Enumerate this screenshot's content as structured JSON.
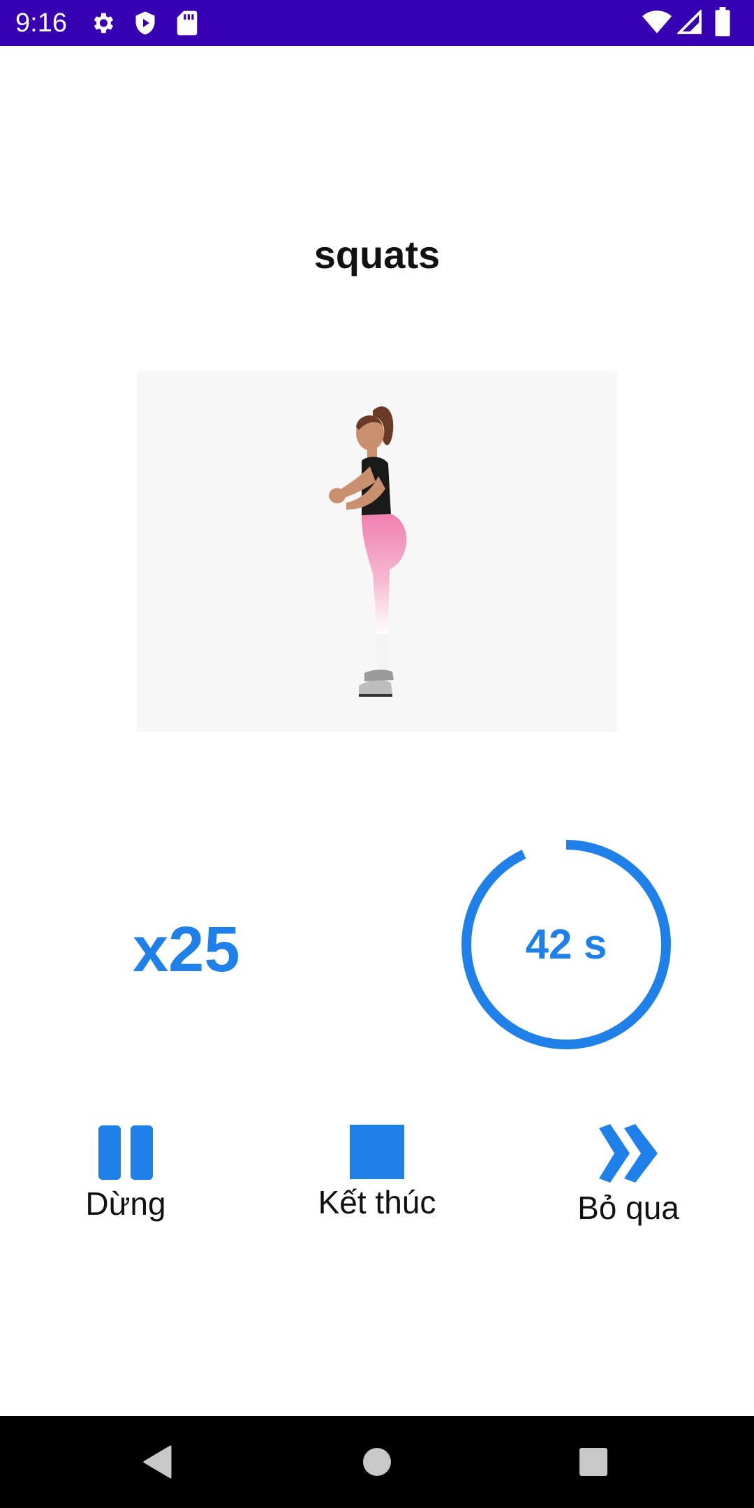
{
  "status_bar": {
    "time": "9:16",
    "left_icons": [
      "settings-icon",
      "shield-play-icon",
      "sd-card-icon"
    ],
    "right_icons": [
      "wifi-icon",
      "cell-signal-icon",
      "battery-icon"
    ],
    "background": "#3700b3"
  },
  "exercise": {
    "title": "squats",
    "image": "woman-squat-figure",
    "reps": "x25",
    "timer_text": "42 s",
    "timer_progress": 0.93,
    "accent": "#1e80e8"
  },
  "controls": {
    "pause_label": "Dừng",
    "end_label": "Kết thúc",
    "skip_label": "Bỏ qua"
  },
  "nav_bar": {
    "buttons": [
      "back-icon",
      "home-icon",
      "recents-icon"
    ]
  }
}
